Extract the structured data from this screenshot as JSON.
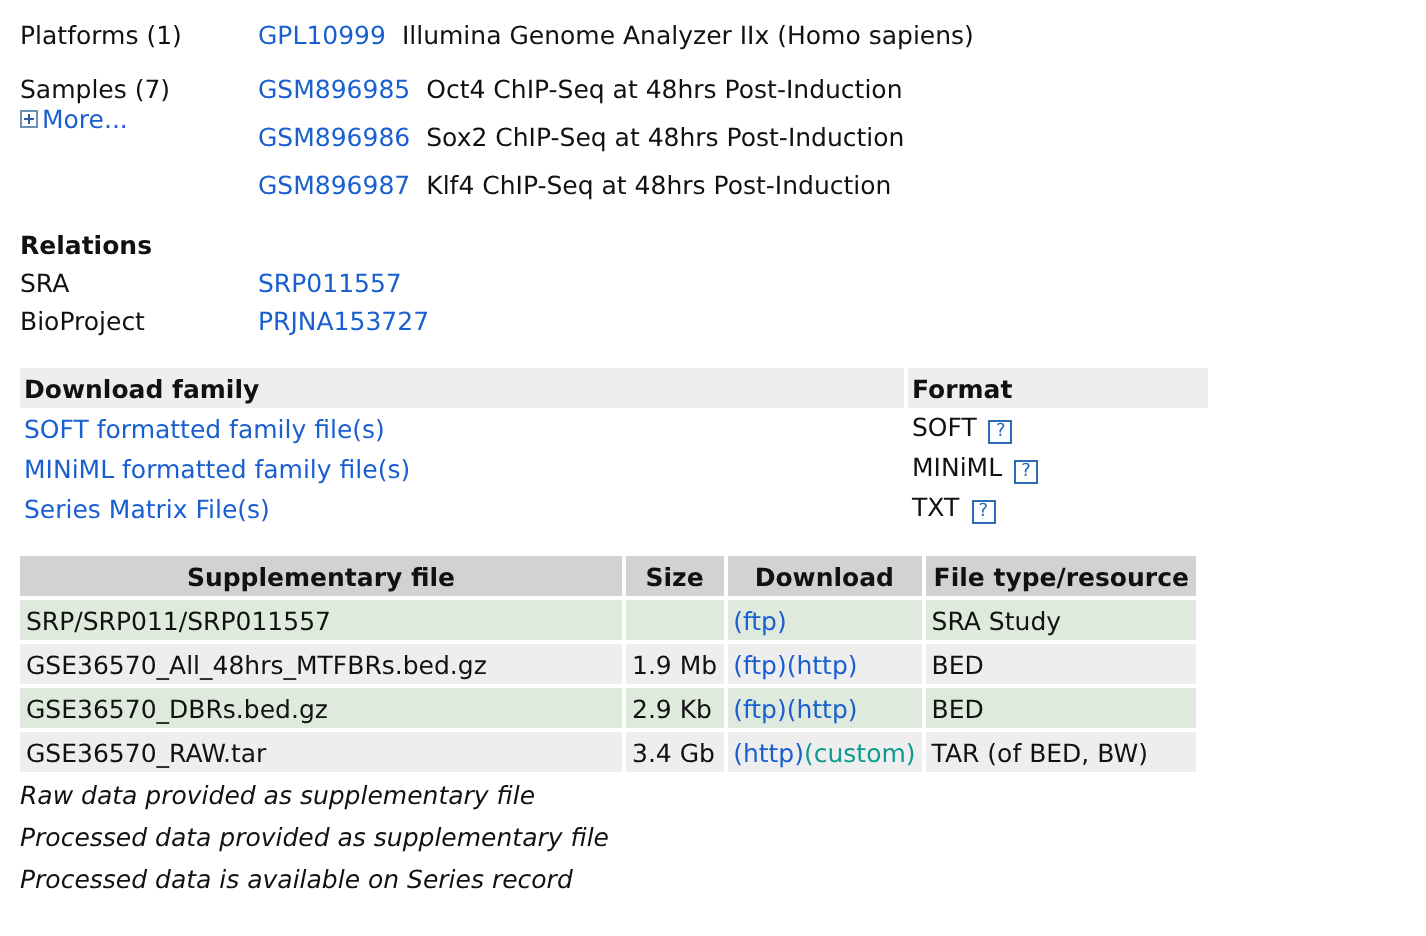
{
  "platforms": {
    "label": "Platforms (1)",
    "items": [
      {
        "accession": "GPL10999",
        "title": "Illumina Genome Analyzer IIx (Homo sapiens)"
      }
    ]
  },
  "samples": {
    "label": "Samples (7)",
    "more": "More...",
    "items": [
      {
        "accession": "GSM896985",
        "title": "Oct4 ChIP-Seq at 48hrs Post-Induction"
      },
      {
        "accession": "GSM896986",
        "title": "Sox2 ChIP-Seq at 48hrs Post-Induction"
      },
      {
        "accession": "GSM896987",
        "title": "Klf4 ChIP-Seq at 48hrs Post-Induction"
      }
    ]
  },
  "relations": {
    "heading": "Relations",
    "items": [
      {
        "label": "SRA",
        "value": "SRP011557"
      },
      {
        "label": "BioProject",
        "value": "PRJNA153727"
      }
    ]
  },
  "download_family": {
    "columns": [
      "Download family",
      "Format"
    ],
    "rows": [
      {
        "link": "SOFT formatted family file(s)",
        "format": "SOFT",
        "help": "?"
      },
      {
        "link": "MINiML formatted family file(s)",
        "format": "MINiML",
        "help": "?"
      },
      {
        "link": "Series Matrix File(s)",
        "format": "TXT",
        "help": "?"
      }
    ]
  },
  "supplementary": {
    "columns": [
      "Supplementary file",
      "Size",
      "Download",
      "File type/resource"
    ],
    "rows": [
      {
        "file": "SRP/SRP011/SRP011557",
        "size": "",
        "links": [
          {
            "text": "(ftp)",
            "kind": "standard"
          }
        ],
        "type": "SRA Study"
      },
      {
        "file": "GSE36570_All_48hrs_MTFBRs.bed.gz",
        "size": "1.9 Mb",
        "links": [
          {
            "text": "(ftp)",
            "kind": "standard"
          },
          {
            "text": "(http)",
            "kind": "standard"
          }
        ],
        "type": "BED"
      },
      {
        "file": "GSE36570_DBRs.bed.gz",
        "size": "2.9 Kb",
        "links": [
          {
            "text": "(ftp)",
            "kind": "standard"
          },
          {
            "text": "(http)",
            "kind": "standard"
          }
        ],
        "type": "BED"
      },
      {
        "file": "GSE36570_RAW.tar",
        "size": "3.4 Gb",
        "links": [
          {
            "text": "(http)",
            "kind": "standard"
          },
          {
            "text": "(custom)",
            "kind": "custom"
          }
        ],
        "type": "TAR (of BED, BW)"
      }
    ]
  },
  "notes": [
    "Raw data provided as supplementary file",
    "Processed data provided as supplementary file",
    "Processed data is available on Series record"
  ]
}
